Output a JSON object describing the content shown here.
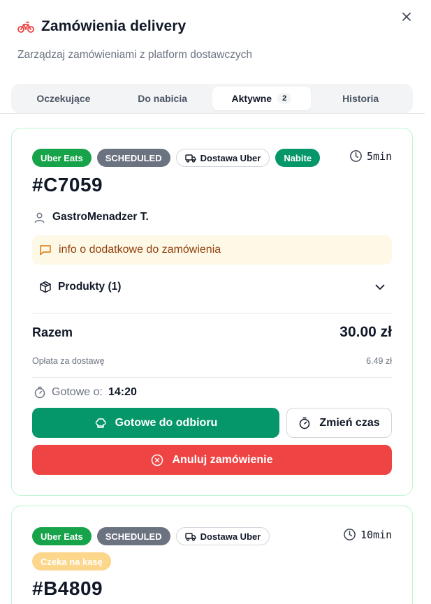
{
  "header": {
    "title": "Zamówienia delivery",
    "subtitle": "Zarządzaj zamówieniami z platform dostawczych",
    "brand_color": "#ef4444"
  },
  "tabs": [
    {
      "label": "Oczekujące"
    },
    {
      "label": "Do nabicia"
    },
    {
      "label": "Aktywne",
      "count": "2"
    },
    {
      "label": "Historia"
    }
  ],
  "orders": [
    {
      "badges": {
        "platform": "Uber Eats",
        "type": "SCHEDULED",
        "delivery": "Dostawa Uber",
        "status": "Nabite"
      },
      "timer": "5min",
      "id": "#C7059",
      "customer": "GastroMenadzer T.",
      "note": "info o dodatkowe do zamówienia",
      "products_label": "Produkty (1)",
      "total_label": "Razem",
      "total_value": "30.00 zł",
      "fee_label": "Opłata za dostawę",
      "fee_value": "6.49 zł",
      "ready_label": "Gotowe o:",
      "ready_time": "14:20",
      "btn_ready": "Gotowe do odbioru",
      "btn_change": "Zmień czas",
      "btn_cancel": "Anuluj zamówienie"
    },
    {
      "badges": {
        "platform": "Uber Eats",
        "type": "SCHEDULED",
        "delivery": "Dostawa Uber",
        "status": "Czeka na kasę"
      },
      "timer": "10min",
      "id": "#B4809"
    }
  ],
  "colors": {
    "green": "#16a34a",
    "teal": "#059669",
    "gray": "#6b7280",
    "amber": "#fcd68a",
    "danger": "#ef4444",
    "card_border": "#bbf7d0"
  }
}
